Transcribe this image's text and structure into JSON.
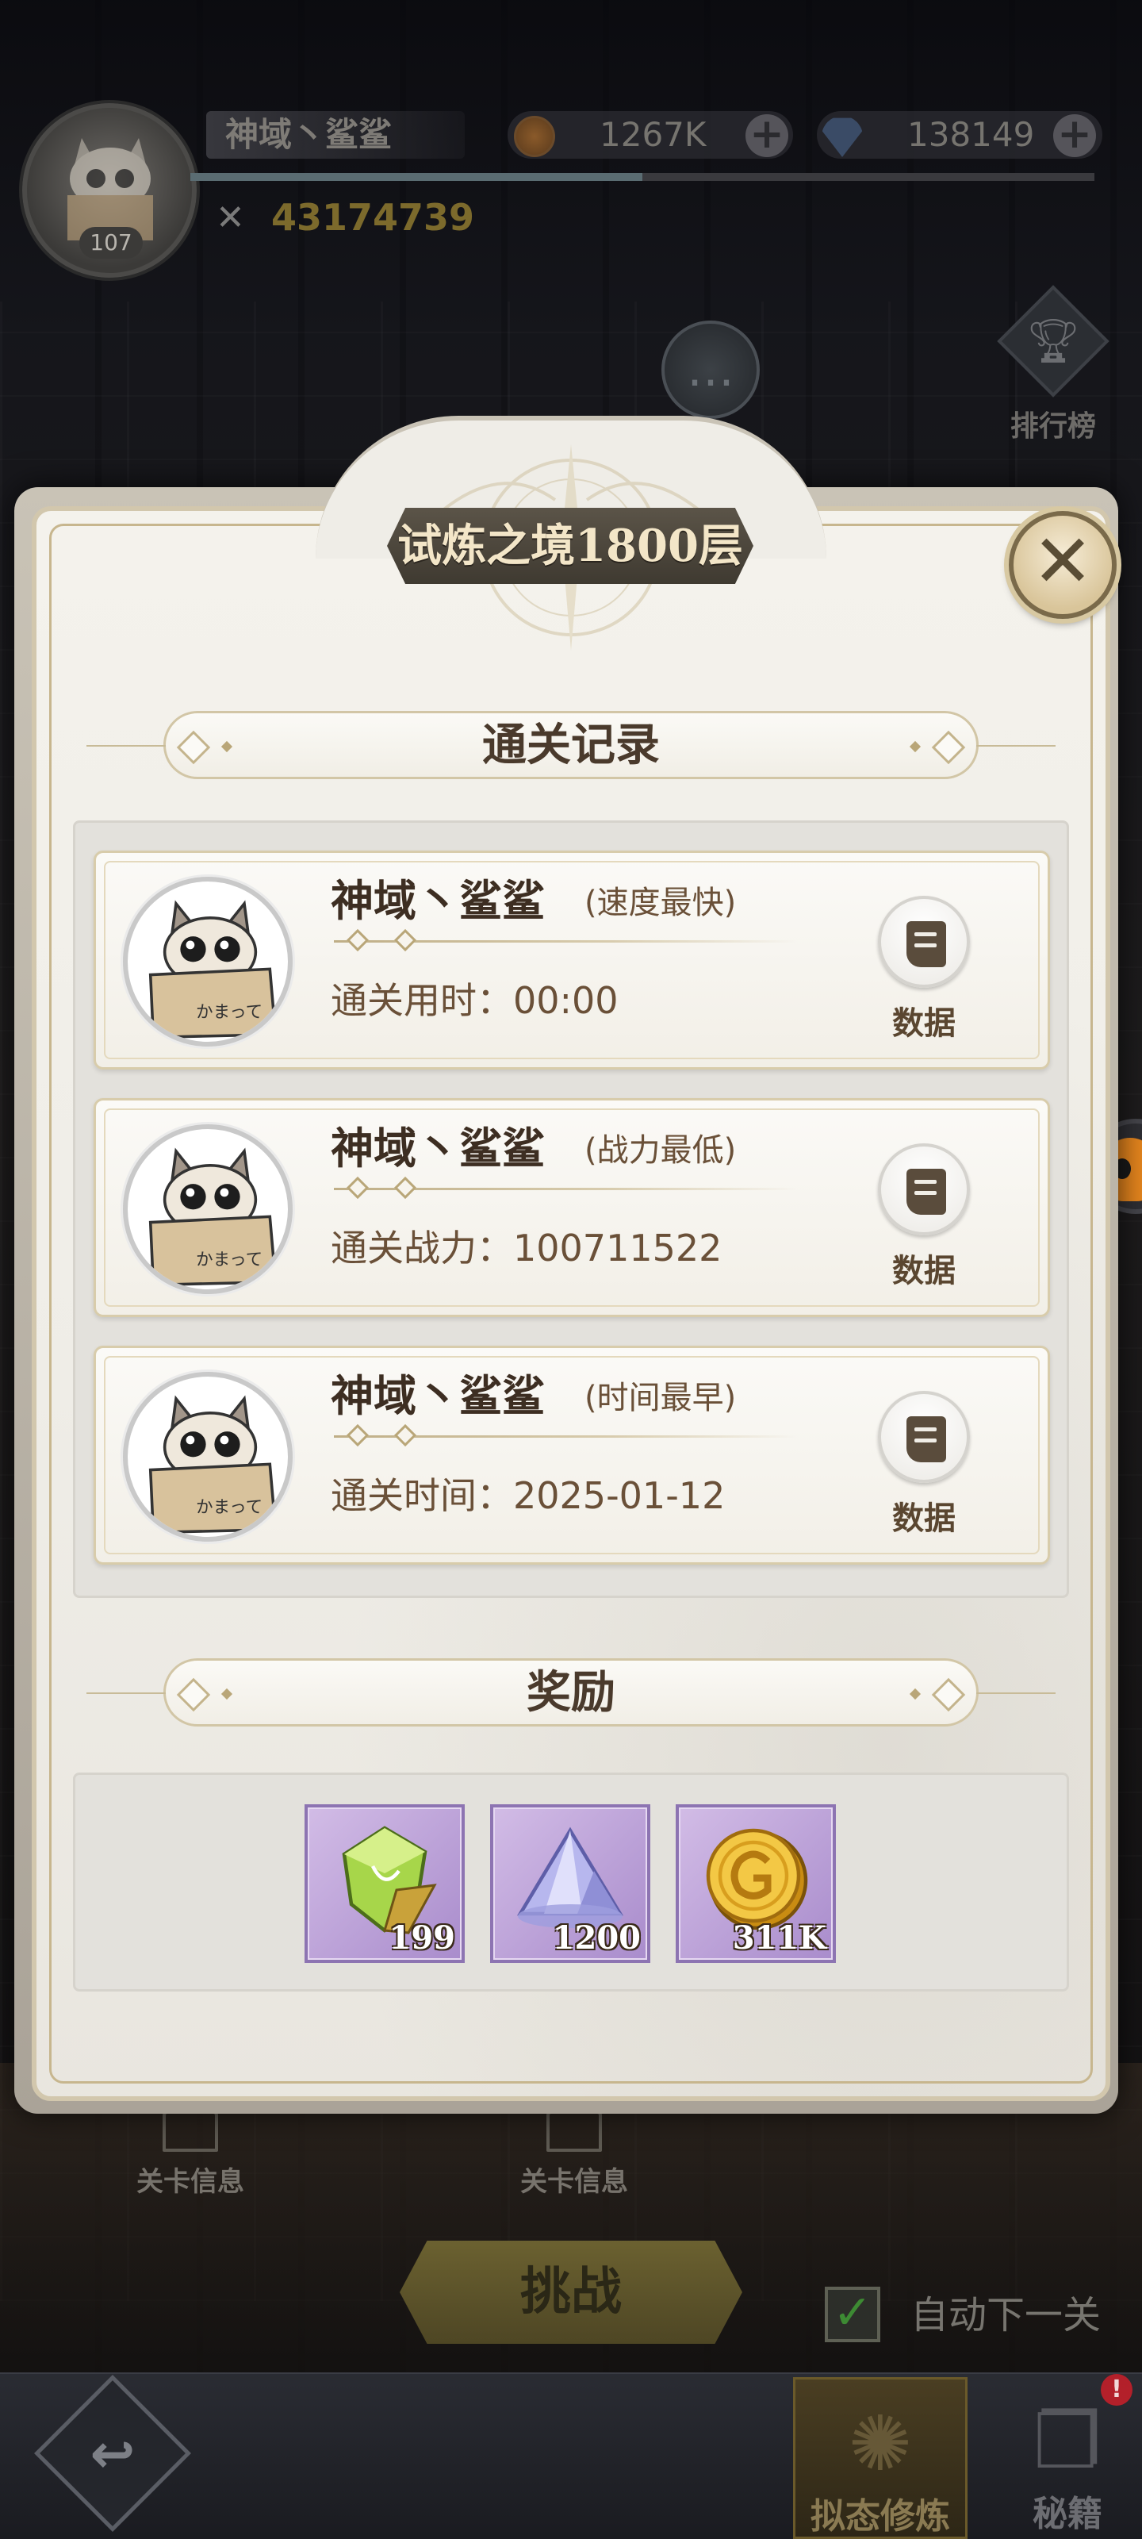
{
  "player": {
    "name": "神域丶鲨鲨",
    "level": "107",
    "power": "43174739",
    "gold": "1267K",
    "diamonds": "138149",
    "xp_fraction": 0.5
  },
  "hud": {
    "ranking_label": "排行榜"
  },
  "modal": {
    "title": "试炼之境1800层",
    "records_header": "通关记录",
    "rewards_header": "奖励",
    "records": [
      {
        "name": "神域丶鲨鲨",
        "tag": "(速度最快)",
        "stat": "通关用时：00:00",
        "data_label": "数据"
      },
      {
        "name": "神域丶鲨鲨",
        "tag": "(战力最低)",
        "stat": "通关战力：100711522",
        "data_label": "数据"
      },
      {
        "name": "神域丶鲨鲨",
        "tag": "(时间最早)",
        "stat": "通关时间：2025-01-12",
        "data_label": "数据"
      }
    ],
    "rewards": [
      {
        "icon": "green-crystal-icon",
        "count": "199"
      },
      {
        "icon": "lavender-crystal-pile-icon",
        "count": "1200"
      },
      {
        "icon": "gold-coin-icon",
        "count": "311K"
      }
    ]
  },
  "background": {
    "stage_info_left": "关卡信息",
    "stage_info_right": "关卡信息",
    "challenge_label": "挑战",
    "auto_next_label": "自动下一关",
    "auto_next_checked": true,
    "tabs": [
      {
        "label": "拟态修炼",
        "active": true
      },
      {
        "label": "秘籍",
        "active": false
      }
    ],
    "notification": "!"
  },
  "colors": {
    "title_plate": "#4d463b",
    "title_text": "#f3e6c8",
    "heading_text": "#4a3a2c",
    "reward_frame": "#8d74b2"
  }
}
